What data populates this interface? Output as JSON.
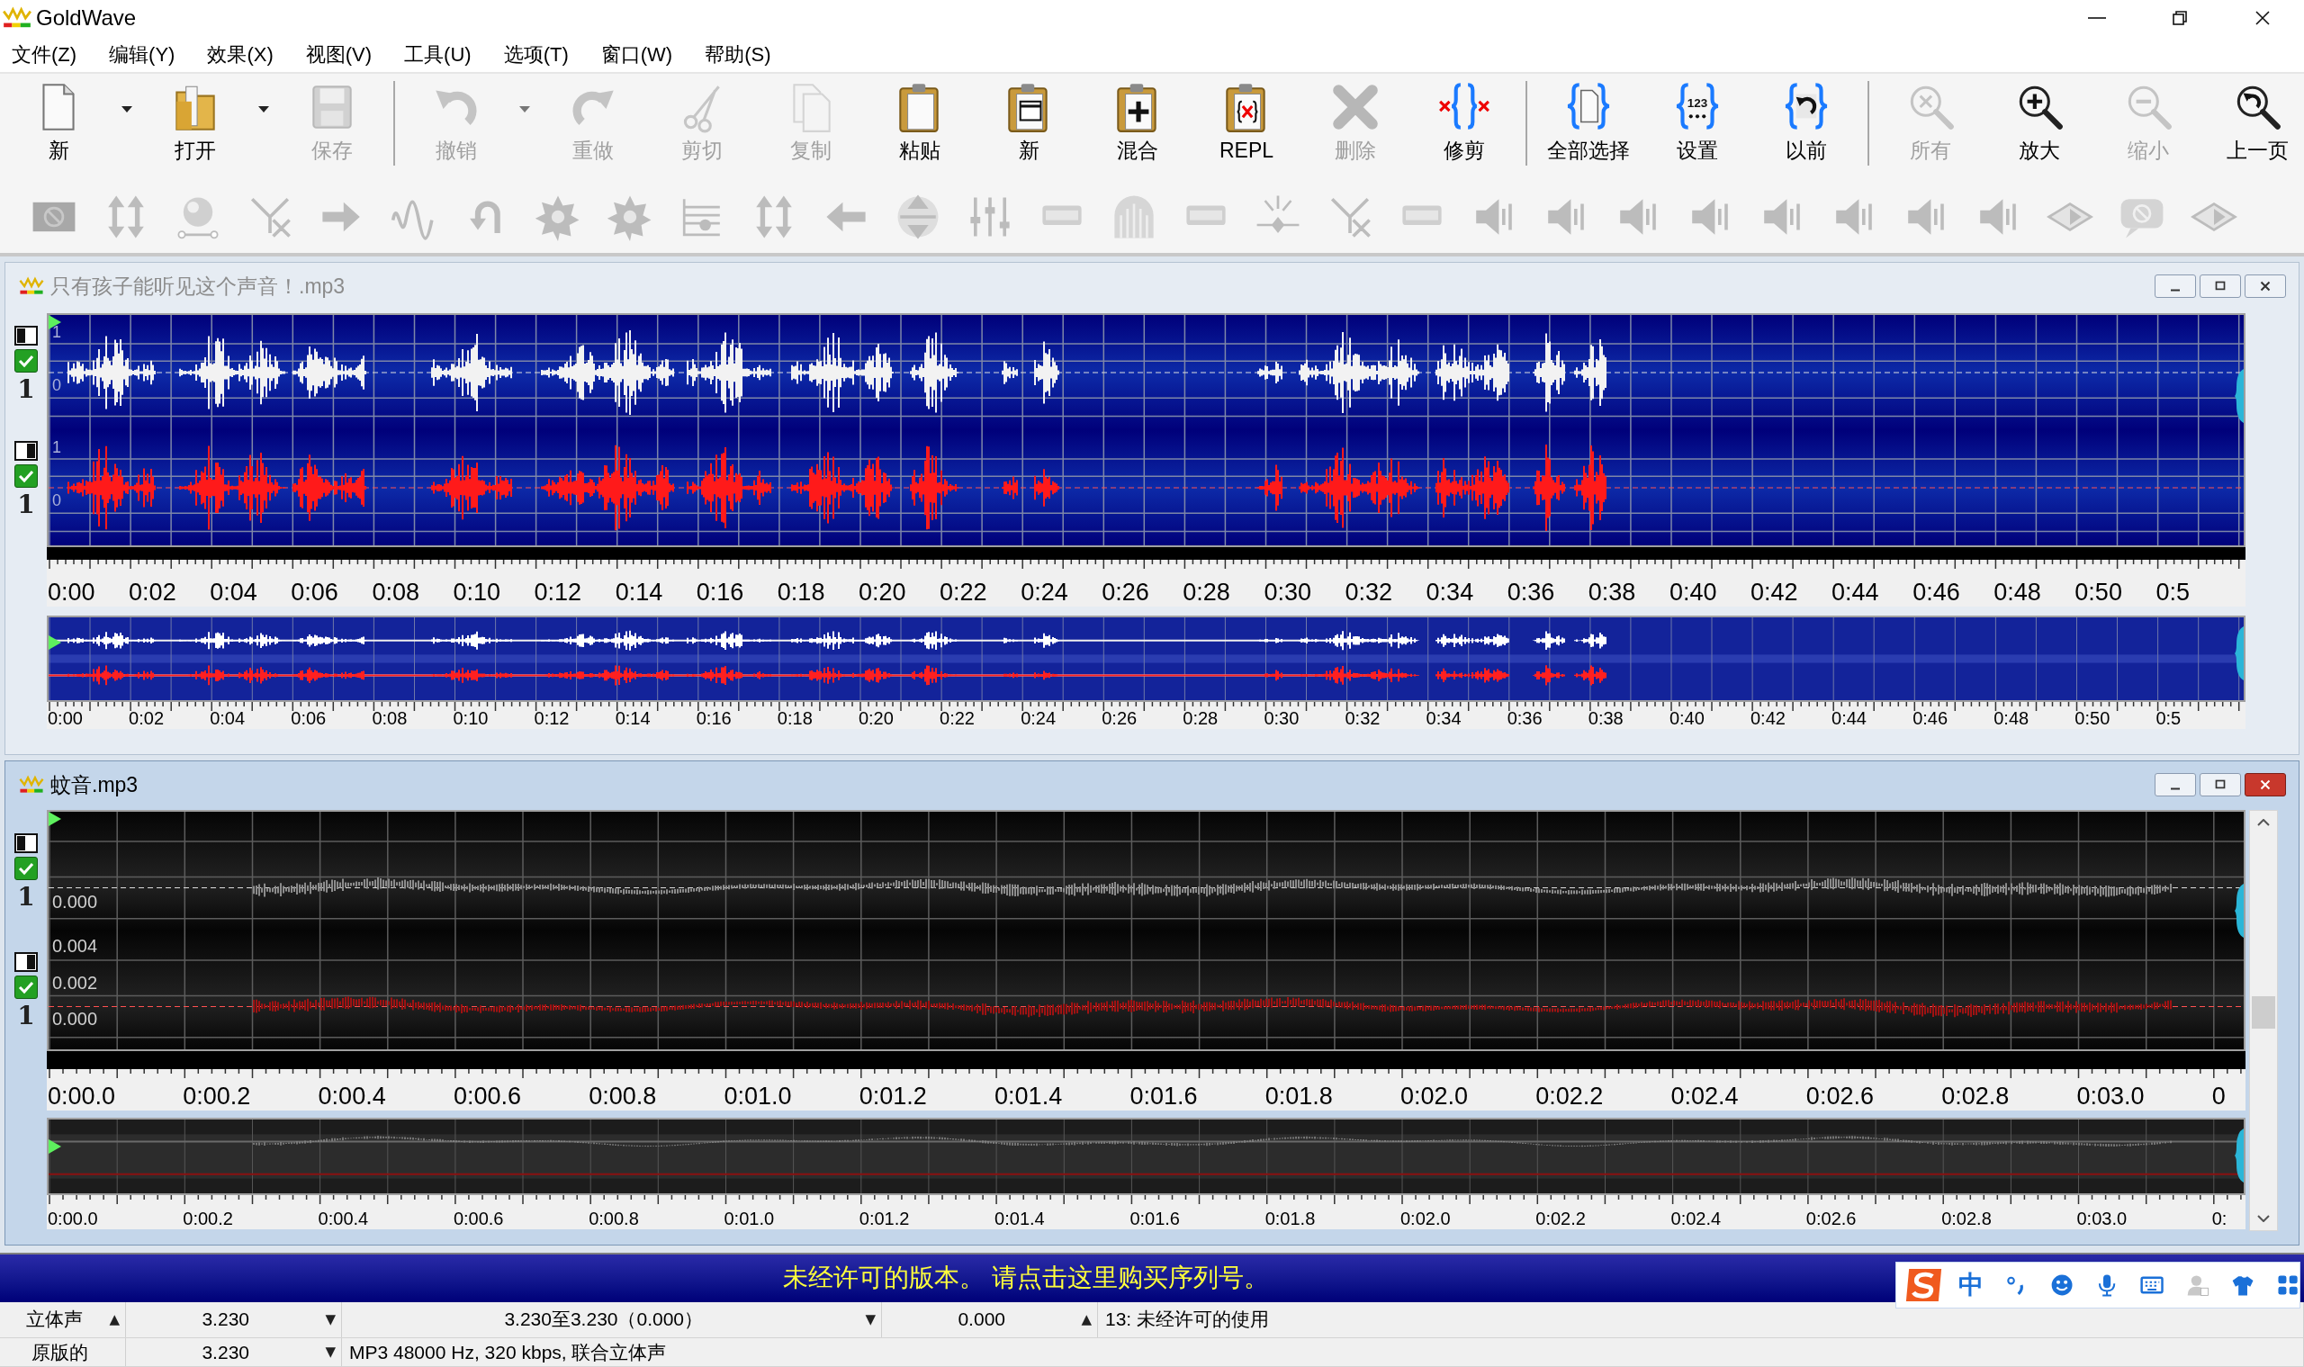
{
  "app": {
    "title": "GoldWave"
  },
  "menu": [
    "文件(Z)",
    "编辑(Y)",
    "效果(X)",
    "视图(V)",
    "工具(U)",
    "选项(T)",
    "窗口(W)",
    "帮助(S)"
  ],
  "toolbar": [
    {
      "kind": "new",
      "label": "新",
      "disabled": false,
      "dropdown": true
    },
    {
      "kind": "open",
      "label": "打开",
      "disabled": false,
      "dropdown": true
    },
    {
      "kind": "save",
      "label": "保存",
      "disabled": true,
      "dropdown": false
    },
    {
      "kind": "separator"
    },
    {
      "kind": "undo",
      "label": "撤销",
      "disabled": true,
      "dropdown": true
    },
    {
      "kind": "redo",
      "label": "重做",
      "disabled": true,
      "dropdown": false
    },
    {
      "kind": "cut",
      "label": "剪切",
      "disabled": true,
      "dropdown": false
    },
    {
      "kind": "copy",
      "label": "复制",
      "disabled": true,
      "dropdown": false
    },
    {
      "kind": "paste",
      "label": "粘贴",
      "disabled": false,
      "dropdown": false
    },
    {
      "kind": "paste_new",
      "label": "新",
      "disabled": false,
      "dropdown": false
    },
    {
      "kind": "mix",
      "label": "混合",
      "disabled": false,
      "dropdown": false
    },
    {
      "kind": "replace",
      "label": "REPL",
      "disabled": false,
      "dropdown": false
    },
    {
      "kind": "delete",
      "label": "删除",
      "disabled": true,
      "dropdown": false
    },
    {
      "kind": "trim",
      "label": "修剪",
      "disabled": false,
      "dropdown": false
    },
    {
      "kind": "separator"
    },
    {
      "kind": "select_all",
      "label": "全部选择",
      "disabled": false,
      "dropdown": false
    },
    {
      "kind": "set",
      "label": "设置",
      "disabled": false,
      "dropdown": false,
      "icon_text": "123"
    },
    {
      "kind": "previous",
      "label": "以前",
      "disabled": false,
      "dropdown": false
    },
    {
      "kind": "separator"
    },
    {
      "kind": "zoom_all",
      "label": "所有",
      "disabled": true,
      "dropdown": false
    },
    {
      "kind": "zoom_in",
      "label": "放大",
      "disabled": false,
      "dropdown": false
    },
    {
      "kind": "zoom_out",
      "label": "缩小",
      "disabled": true,
      "dropdown": false
    },
    {
      "kind": "zoom_prev",
      "label": "上一页",
      "disabled": false,
      "dropdown": false
    }
  ],
  "documents": [
    {
      "title": "只有孩子能听见这个声音！.mp3",
      "active": false,
      "kind": "speech",
      "channels": [
        {
          "checked": true,
          "number": "1",
          "scale": [
            "1",
            "0"
          ]
        },
        {
          "checked": true,
          "number": "1",
          "scale": [
            "1",
            "0"
          ]
        }
      ],
      "ruler": [
        "0:00",
        "0:02",
        "0:04",
        "0:06",
        "0:08",
        "0:10",
        "0:12",
        "0:14",
        "0:16",
        "0:18",
        "0:20",
        "0:22",
        "0:24",
        "0:26",
        "0:28",
        "0:30",
        "0:32",
        "0:34",
        "0:36",
        "0:38",
        "0:40",
        "0:42",
        "0:44",
        "0:46",
        "0:48",
        "0:50",
        "0:5"
      ],
      "overview_ruler": [
        "0:00",
        "0:02",
        "0:04",
        "0:06",
        "0:08",
        "0:10",
        "0:12",
        "0:14",
        "0:16",
        "0:18",
        "0:20",
        "0:22",
        "0:24",
        "0:26",
        "0:28",
        "0:30",
        "0:32",
        "0:34",
        "0:36",
        "0:38",
        "0:40",
        "0:42",
        "0:44",
        "0:46",
        "0:48",
        "0:50",
        "0:5"
      ]
    },
    {
      "title": "蚊音.mp3",
      "active": true,
      "kind": "tone",
      "vertical_scrollbar": true,
      "channels": [
        {
          "checked": true,
          "number": "1",
          "scale": [
            "0.000"
          ]
        },
        {
          "checked": true,
          "number": "1",
          "scale": [
            "0.004",
            "0.002",
            "0.000"
          ]
        }
      ],
      "ruler": [
        "0:00.0",
        "0:00.2",
        "0:00.4",
        "0:00.6",
        "0:00.8",
        "0:01.0",
        "0:01.2",
        "0:01.4",
        "0:01.6",
        "0:01.8",
        "0:02.0",
        "0:02.2",
        "0:02.4",
        "0:02.6",
        "0:02.8",
        "0:03.0",
        "0"
      ],
      "overview_ruler": [
        "0:00.0",
        "0:00.2",
        "0:00.4",
        "0:00.6",
        "0:00.8",
        "0:01.0",
        "0:01.2",
        "0:01.4",
        "0:01.6",
        "0:01.8",
        "0:02.0",
        "0:02.2",
        "0:02.4",
        "0:02.6",
        "0:02.8",
        "0:03.0",
        "0:"
      ]
    }
  ],
  "notice": "未经许可的版本。 请点击这里购买序列号。",
  "status_bar": {
    "rows": [
      [
        {
          "text": "立体声",
          "arrow": "▲"
        },
        {
          "text": "3.230",
          "arrow": "▼"
        },
        {
          "text": "3.230至3.230（0.000）",
          "arrow": "▼"
        },
        {
          "text": "0.000",
          "arrow": "▲"
        },
        {
          "text": "13: 未经许可的使用"
        }
      ],
      [
        {
          "text": "原版的"
        },
        {
          "text": "3.230",
          "arrow": "▼"
        },
        {
          "text": "MP3 48000 Hz, 320 kbps, 联合立体声"
        }
      ]
    ]
  },
  "ime_bar": {
    "mode": "中"
  }
}
